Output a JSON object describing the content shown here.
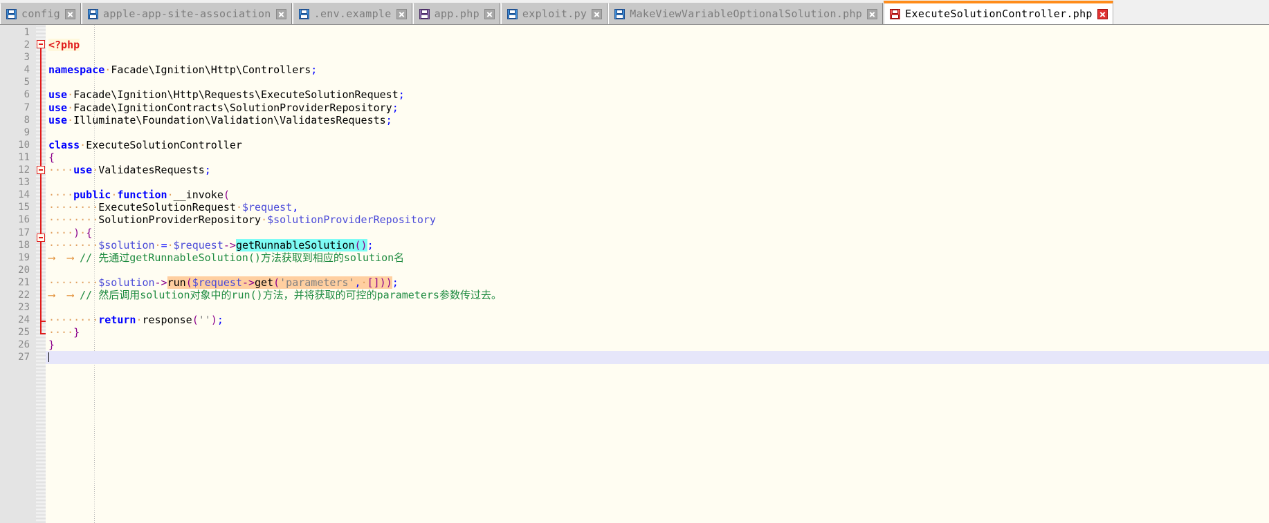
{
  "window": {
    "app": "Notepad++",
    "active_file": "ExecuteSolutionController.php"
  },
  "tabs": [
    {
      "label": "config",
      "icon": "floppy-disk-icon",
      "icon_color": "#3f8fd8",
      "active": false,
      "close_label": "x"
    },
    {
      "label": "apple-app-site-association",
      "icon": "floppy-disk-icon",
      "icon_color": "#3f8fd8",
      "active": false,
      "close_label": "x"
    },
    {
      "label": ".env.example",
      "icon": "floppy-disk-icon",
      "icon_color": "#3f8fd8",
      "active": false,
      "close_label": "x"
    },
    {
      "label": "app.php",
      "icon": "floppy-disk-icon",
      "icon_color": "#8f6fb0",
      "active": false,
      "close_label": "x"
    },
    {
      "label": "exploit.py",
      "icon": "floppy-disk-icon",
      "icon_color": "#3f8fd8",
      "active": false,
      "close_label": "x"
    },
    {
      "label": "MakeViewVariableOptionalSolution.php",
      "icon": "floppy-disk-icon",
      "icon_color": "#3f8fd8",
      "active": false,
      "close_label": "x"
    },
    {
      "label": "ExecuteSolutionController.php",
      "icon": "floppy-disk-icon",
      "icon_color": "#f05b5b",
      "active": true,
      "close_label": "x"
    }
  ],
  "editor": {
    "language": "PHP",
    "line_numbers": [
      1,
      2,
      3,
      4,
      5,
      6,
      7,
      8,
      9,
      10,
      11,
      12,
      13,
      14,
      15,
      16,
      17,
      18,
      19,
      20,
      21,
      22,
      23,
      24,
      25,
      26,
      27
    ],
    "active_line": 27,
    "colors": {
      "background": "#fffdf2",
      "gutter": "#e4e4e4",
      "keyword": "#0000ff",
      "comment": "#1d8a3f",
      "string": "#808080",
      "variable": "#4a4ad8",
      "paren": "#8b008b",
      "php_tag": "#e01b1b",
      "highlight_cyan": "#7efcf5",
      "highlight_orange": "#ffcfa0",
      "whitespace_dot": "#e0a060",
      "tab_arrow": "#e08a2e",
      "fold_line": "#e01b1b",
      "caret_line": "#e6e6fa",
      "active_tab_top": "#ff8c1a"
    },
    "lines": [
      {
        "n": 1,
        "text": ""
      },
      {
        "n": 2,
        "text": "<?php"
      },
      {
        "n": 3,
        "text": ""
      },
      {
        "n": 4,
        "text": "namespace Facade\\Ignition\\Http\\Controllers;"
      },
      {
        "n": 5,
        "text": ""
      },
      {
        "n": 6,
        "text": "use Facade\\Ignition\\Http\\Requests\\ExecuteSolutionRequest;"
      },
      {
        "n": 7,
        "text": "use Facade\\IgnitionContracts\\SolutionProviderRepository;"
      },
      {
        "n": 8,
        "text": "use Illuminate\\Foundation\\Validation\\ValidatesRequests;"
      },
      {
        "n": 9,
        "text": ""
      },
      {
        "n": 10,
        "text": "class ExecuteSolutionController"
      },
      {
        "n": 11,
        "text": "{"
      },
      {
        "n": 12,
        "text": "    use ValidatesRequests;"
      },
      {
        "n": 13,
        "text": ""
      },
      {
        "n": 14,
        "text": "    public function __invoke("
      },
      {
        "n": 15,
        "text": "        ExecuteSolutionRequest $request,"
      },
      {
        "n": 16,
        "text": "        SolutionProviderRepository $solutionProviderRepository"
      },
      {
        "n": 17,
        "text": "    ) {"
      },
      {
        "n": 18,
        "text": "        $solution = $request->getRunnableSolution();"
      },
      {
        "n": 19,
        "text": "\t\t// 先通过getRunnableSolution()方法获取到相应的solution名"
      },
      {
        "n": 20,
        "text": ""
      },
      {
        "n": 21,
        "text": "        $solution->run($request->get('parameters', []));"
      },
      {
        "n": 22,
        "text": "\t\t// 然后调用solution对象中的run()方法，并将获取的可控的parameters参数传过去。"
      },
      {
        "n": 23,
        "text": ""
      },
      {
        "n": 24,
        "text": "        return response('');"
      },
      {
        "n": 25,
        "text": "    }"
      },
      {
        "n": 26,
        "text": "}"
      },
      {
        "n": 27,
        "text": ""
      }
    ],
    "highlighted_tokens": [
      {
        "line": 18,
        "text": "getRunnableSolution()",
        "background": "#7efcf5"
      },
      {
        "line": 21,
        "text": "run($request->get('parameters', []))",
        "background": "#ffcfa0"
      }
    ],
    "comments": [
      {
        "line": 19,
        "text": "// 先通过getRunnableSolution()方法获取到相应的solution名"
      },
      {
        "line": 22,
        "text": "// 然后调用solution对象中的run()方法，并将获取的可控的parameters参数传过去。"
      }
    ]
  }
}
